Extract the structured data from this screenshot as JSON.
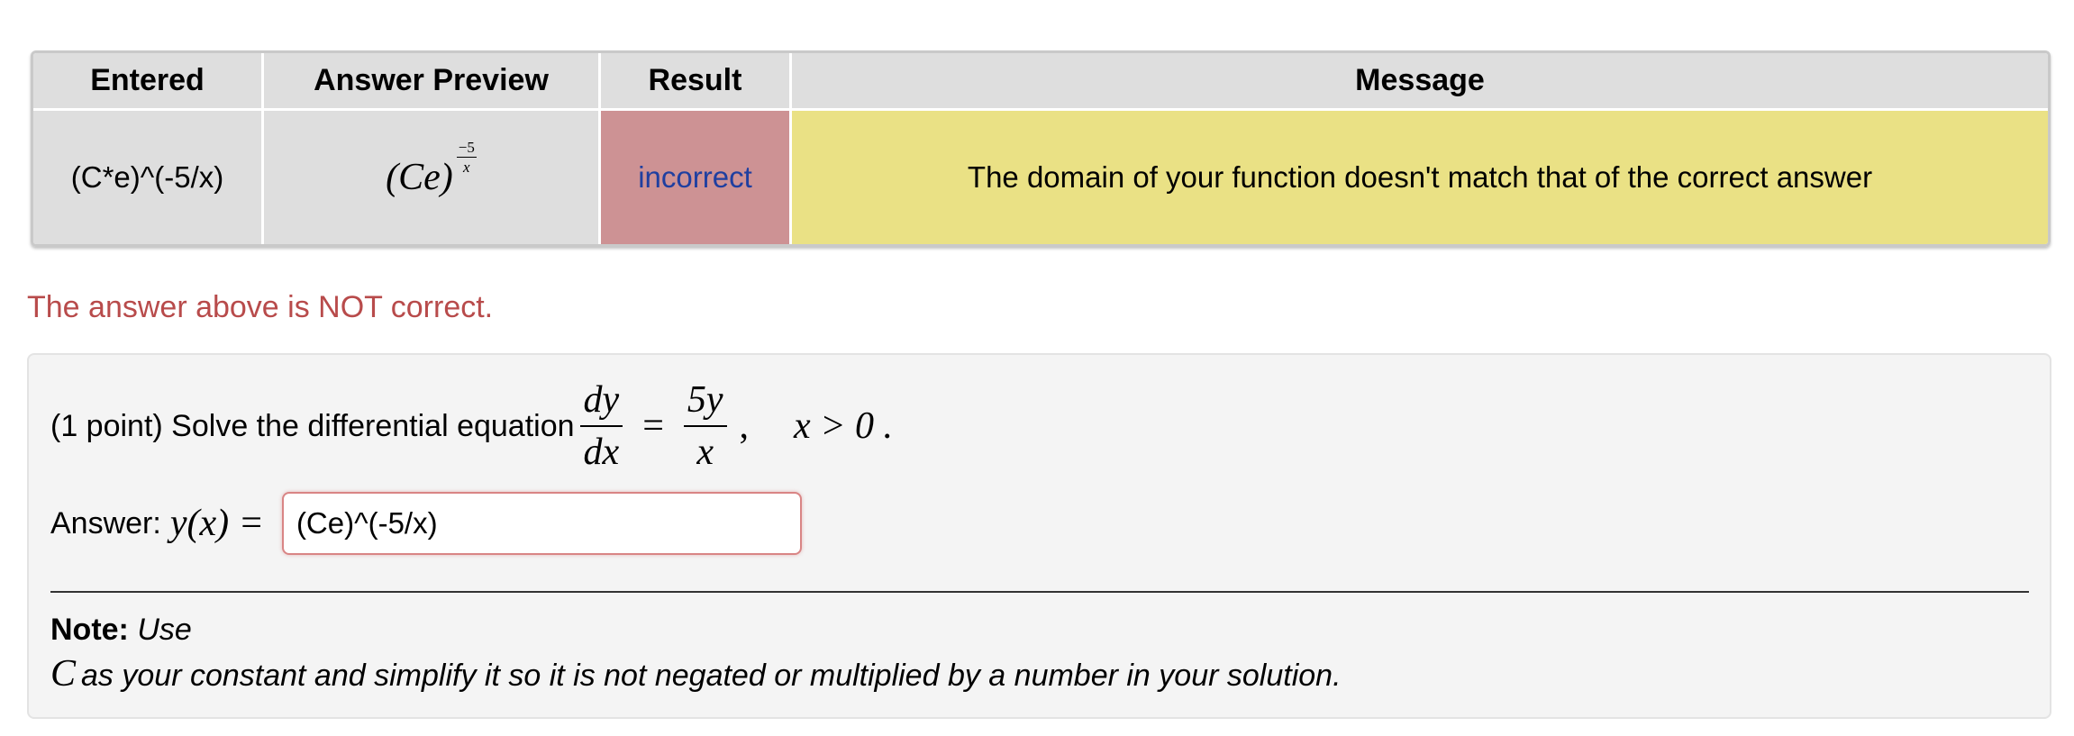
{
  "results_table": {
    "headers": {
      "entered": "Entered",
      "preview": "Answer Preview",
      "result": "Result",
      "message": "Message"
    },
    "row": {
      "entered": "(C*e)^(-5/x)",
      "preview_base": "(Ce)",
      "preview_exp_num": "−5",
      "preview_exp_den": "x",
      "result": "incorrect",
      "message": "The domain of your function doesn't match that of the correct answer"
    },
    "colors": {
      "result_bg": "#cd9294",
      "result_text": "#1f3fa0",
      "message_bg": "#eae185",
      "header_bg": "#dedede"
    }
  },
  "status_message": "The answer above is NOT correct.",
  "problem": {
    "prefix": "(1 point) Solve the differential equation",
    "lhs_num": "dy",
    "lhs_den": "dx",
    "equals": "=",
    "rhs_num": "5y",
    "rhs_den": "x",
    "comma": ",",
    "condition": "x > 0 ."
  },
  "answer": {
    "label": "Answer:",
    "math": "y(x) =",
    "value": "(Ce)^(-5/x)"
  },
  "note": {
    "label": "Note:",
    "use": "Use",
    "variable": "C",
    "text": "as your constant and simplify it so it is not negated or multiplied by a number in your solution."
  }
}
